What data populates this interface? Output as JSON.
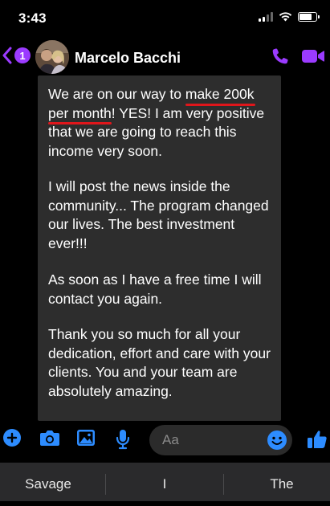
{
  "status": {
    "time": "3:43",
    "icons": [
      "cellular-signal-icon",
      "wifi-icon",
      "battery-icon"
    ],
    "battery_level": 0.8
  },
  "header": {
    "back_badge": "1",
    "contact_name": "Marcelo Bacchi",
    "icons": [
      "back-chevron-icon",
      "phone-icon",
      "video-camera-icon"
    ]
  },
  "message": {
    "p1_before": "We are on our way to ",
    "p1_hl1": "make 200k",
    "p1_hl2": "per month",
    "p1_after": "! YES! I am very positive that we are going to reach this income very soon.",
    "p2": "I will post the news inside the community... The program changed our lives. The best investment ever!!!",
    "p3": "As soon as I have a free time I will contact you again.",
    "p4": "Thank you so much for all your dedication, effort and care with your clients. You and your team are absolutely amazing."
  },
  "composer": {
    "placeholder": "Aa",
    "icons": [
      "plus-icon",
      "camera-icon",
      "photo-icon",
      "microphone-icon",
      "emoji-icon",
      "thumbs-up-icon"
    ]
  },
  "keyboard": {
    "suggestions": [
      "Savage",
      "I",
      "The"
    ]
  },
  "colors": {
    "accent": "#9b3bff",
    "blue": "#2d8cff",
    "bubble": "#2d2d2d",
    "underline": "#e0161b"
  }
}
